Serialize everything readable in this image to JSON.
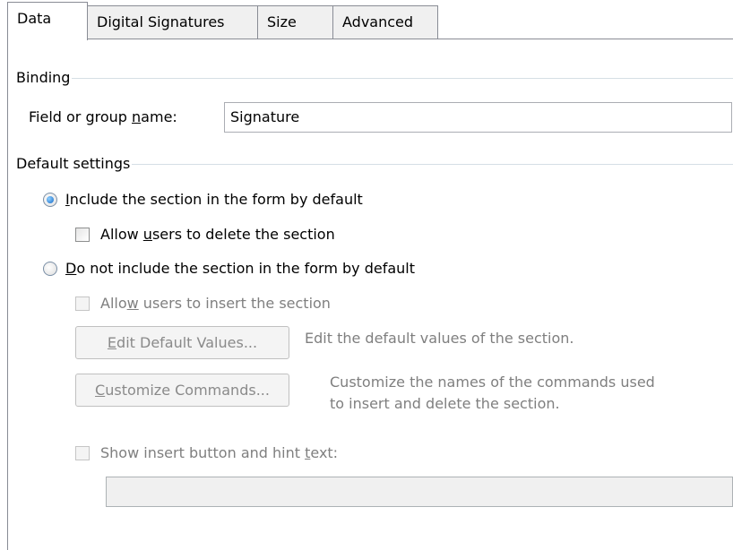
{
  "tabs": [
    {
      "label": "Data",
      "active": true
    },
    {
      "label": "Digital Signatures",
      "active": false
    },
    {
      "label": "Size",
      "active": false
    },
    {
      "label": "Advanced",
      "active": false
    }
  ],
  "binding": {
    "group_label": "Binding",
    "field_label_pre": "Field or group ",
    "field_label_mnemonic": "n",
    "field_label_post": "ame:",
    "field_value": "Signature"
  },
  "defaults": {
    "group_label": "Default settings",
    "include_radio": {
      "mnemonic": "I",
      "rest": "nclude the section in the form by default",
      "selected": true
    },
    "allow_delete": {
      "pre": "Allow ",
      "mnemonic": "u",
      "post": "sers to delete the section",
      "checked": false
    },
    "exclude_radio": {
      "mnemonic": "D",
      "rest": "o not include the section in the form by default",
      "selected": false
    },
    "allow_insert": {
      "pre": "Allo",
      "mnemonic": "w",
      "post": " users to insert the section",
      "checked": false,
      "disabled": true
    },
    "edit_defaults_button": {
      "mnemonic": "E",
      "rest": "dit Default Values..."
    },
    "edit_defaults_desc": "Edit the default values of the section.",
    "customize_button": {
      "mnemonic": "C",
      "rest": "ustomize Commands..."
    },
    "customize_desc_line1": "Customize the names of the commands used",
    "customize_desc_line2": "to insert and delete the section.",
    "show_insert": {
      "pre": "Show insert button and hint ",
      "mnemonic": "t",
      "post": "ext:",
      "checked": false,
      "disabled": true
    },
    "hint_text_value": ""
  }
}
